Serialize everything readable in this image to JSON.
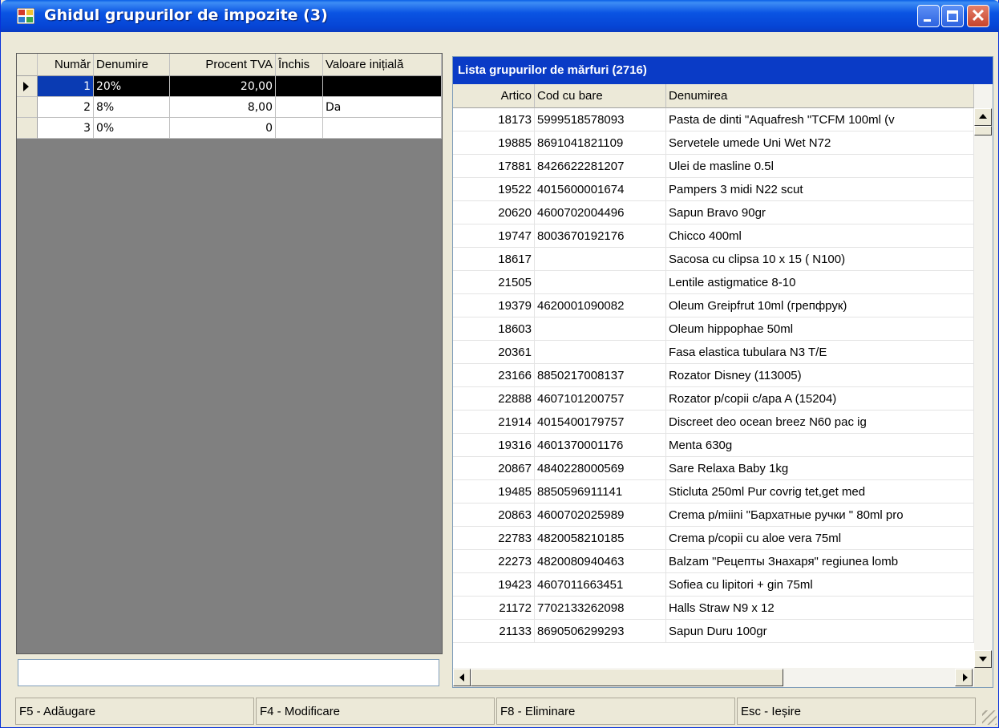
{
  "window": {
    "title": "Ghidul grupurilor de impozite (3)",
    "icons": {
      "app": "grid-app-icon",
      "minimize": "minimize-icon",
      "maximize": "maximize-icon",
      "close": "close-icon"
    }
  },
  "tax_grid": {
    "columns": [
      "Număr",
      "Denumire",
      "Procent TVA",
      "Închis",
      "Valoare inițială"
    ],
    "rows": [
      {
        "nr": "1",
        "name": "20%",
        "percent": "20,00",
        "closed": "",
        "initial": ""
      },
      {
        "nr": "2",
        "name": "8%",
        "percent": "8,00",
        "closed": "",
        "initial": "Da"
      },
      {
        "nr": "3",
        "name": "0%",
        "percent": "0",
        "closed": "",
        "initial": ""
      }
    ],
    "selected_row": 0,
    "search_value": ""
  },
  "goods_panel": {
    "caption": "Lista grupurilor de mărfuri (2716)",
    "columns": [
      "Artico",
      "Cod cu bare",
      "Denumirea"
    ],
    "rows": [
      {
        "art": "18173",
        "barcode": "5999518578093",
        "name": "Pasta de dinti \"Aquafresh \"TCFM  100ml (v"
      },
      {
        "art": "19885",
        "barcode": "8691041821109",
        "name": "Servetele umede Uni Wet N72"
      },
      {
        "art": "17881",
        "barcode": "8426622281207",
        "name": "Ulei de masline 0.5l"
      },
      {
        "art": "19522",
        "barcode": "4015600001674",
        "name": "Pampers 3 midi N22 scut"
      },
      {
        "art": "20620",
        "barcode": "4600702004496",
        "name": "Sapun Bravo 90gr"
      },
      {
        "art": "19747",
        "barcode": "8003670192176",
        "name": "Chicco 400ml"
      },
      {
        "art": "18617",
        "barcode": "",
        "name": "Sacosa cu clipsa 10 x 15 ( N100)"
      },
      {
        "art": "21505",
        "barcode": "",
        "name": "Lentile astigmatice 8-10"
      },
      {
        "art": "19379",
        "barcode": "4620001090082",
        "name": "Oleum Greipfrut 10ml (грепфрук)"
      },
      {
        "art": "18603",
        "barcode": "",
        "name": "Oleum hippophae 50ml"
      },
      {
        "art": "20361",
        "barcode": "",
        "name": "Fasa elastica tubulara N3 T/E"
      },
      {
        "art": "23166",
        "barcode": "8850217008137",
        "name": "Rozator Disney (113005)"
      },
      {
        "art": "22888",
        "barcode": "4607101200757",
        "name": "Rozator p/copii c/apa  A (15204)"
      },
      {
        "art": "21914",
        "barcode": "4015400179757",
        "name": "Discreet deo ocean breez N60 pac ig"
      },
      {
        "art": "19316",
        "barcode": "4601370001176",
        "name": "Menta  630g"
      },
      {
        "art": "20867",
        "barcode": "4840228000569",
        "name": "Sare Relaxa Baby 1kg"
      },
      {
        "art": "19485",
        "barcode": "8850596911141",
        "name": "Sticluta 250ml Pur covrig tet,get med"
      },
      {
        "art": "20863",
        "barcode": "4600702025989",
        "name": "Crema p/miini \"Бархатные ручки \" 80ml pro"
      },
      {
        "art": "22783",
        "barcode": "4820058210185",
        "name": "Crema  p/copii cu aloe vera 75ml"
      },
      {
        "art": "22273",
        "barcode": "4820080940463",
        "name": "Balzam \"Рецепты Знахаря\" regiunea lomb"
      },
      {
        "art": "19423",
        "barcode": "4607011663451",
        "name": "Sofiea cu lipitori + gin 75ml"
      },
      {
        "art": "21172",
        "barcode": "7702133262098",
        "name": "Halls Straw N9 x 12"
      },
      {
        "art": "21133",
        "barcode": "8690506299293",
        "name": "Sapun Duru 100gr"
      }
    ]
  },
  "statusbar": {
    "f5": "F5 - Adăugare",
    "f4": "F4 - Modificare",
    "f8": "F8 - Eliminare",
    "esc": "Esc - Ieșire"
  }
}
